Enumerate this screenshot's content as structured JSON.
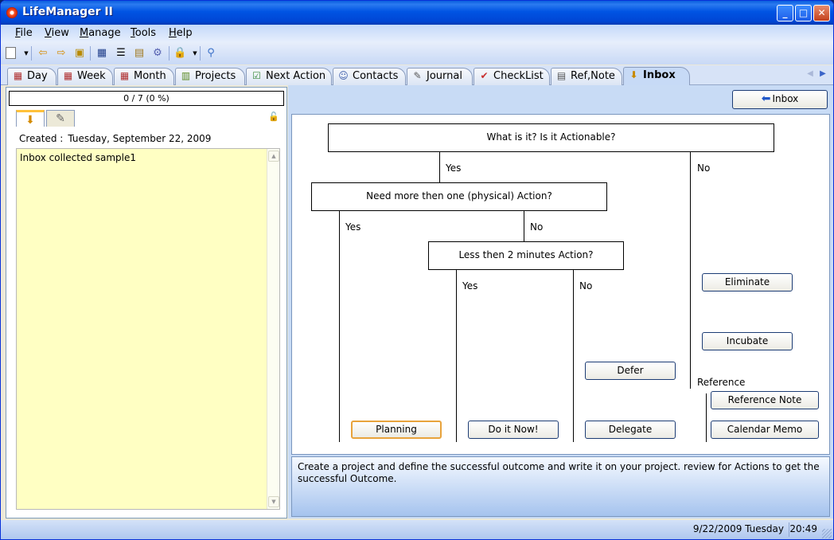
{
  "window": {
    "title": "LifeManager II",
    "minimize": "_",
    "maximize": "□",
    "close": "✕"
  },
  "menu": [
    {
      "label": "File",
      "key": "F",
      "rest": "ile"
    },
    {
      "label": "View",
      "key": "V",
      "rest": "iew"
    },
    {
      "label": "Manage",
      "key": "M",
      "rest": "anage"
    },
    {
      "label": "Tools",
      "key": "T",
      "rest": "ools"
    },
    {
      "label": "Help",
      "key": "H",
      "rest": "elp"
    }
  ],
  "toolbar_icons": [
    "new-document-icon",
    "dropdown-arrow-icon",
    "import-icon",
    "export-icon",
    "archive-icon",
    "grid-icon",
    "tree-icon",
    "database-icon",
    "settings-icon",
    "lock-icon",
    "dropdown-arrow-icon",
    "search-icon"
  ],
  "tabs": [
    {
      "label": "Day",
      "icon": "calendar-day-icon"
    },
    {
      "label": "Week",
      "icon": "calendar-week-icon"
    },
    {
      "label": "Month",
      "icon": "calendar-month-icon"
    },
    {
      "label": "Projects",
      "icon": "projects-icon"
    },
    {
      "label": "Next Action",
      "icon": "next-action-icon"
    },
    {
      "label": "Contacts",
      "icon": "contacts-icon"
    },
    {
      "label": "Journal",
      "icon": "journal-icon"
    },
    {
      "label": "CheckList",
      "icon": "checklist-icon"
    },
    {
      "label": "Ref,Note",
      "icon": "ref-note-icon"
    },
    {
      "label": "Inbox",
      "icon": "inbox-icon",
      "active": true
    }
  ],
  "left": {
    "progress": "0 / 7 (0 %)",
    "created_label": "Created :",
    "created_value": "Tuesday, September 22, 2009",
    "note_text": "Inbox collected sample1"
  },
  "right": {
    "inbox_button": "Inbox",
    "flow": {
      "q1": "What is it? Is it Actionable?",
      "q2": "Need more then one (physical) Action?",
      "q3": "Less then 2 minutes Action?",
      "yes": "Yes",
      "no": "No",
      "reference": "Reference",
      "buttons": {
        "planning": "Planning",
        "do_it_now": "Do it Now!",
        "delegate": "Delegate",
        "defer": "Defer",
        "eliminate": "Eliminate",
        "incubate": "Incubate",
        "reference_note": "Reference Note",
        "calendar_memo": "Calendar Memo"
      }
    },
    "description": "Create a project and define the successful outcome and write it on your project. review for Actions to get the successful Outcome."
  },
  "status": {
    "date": "9/22/2009 Tuesday",
    "time": "20:49"
  }
}
